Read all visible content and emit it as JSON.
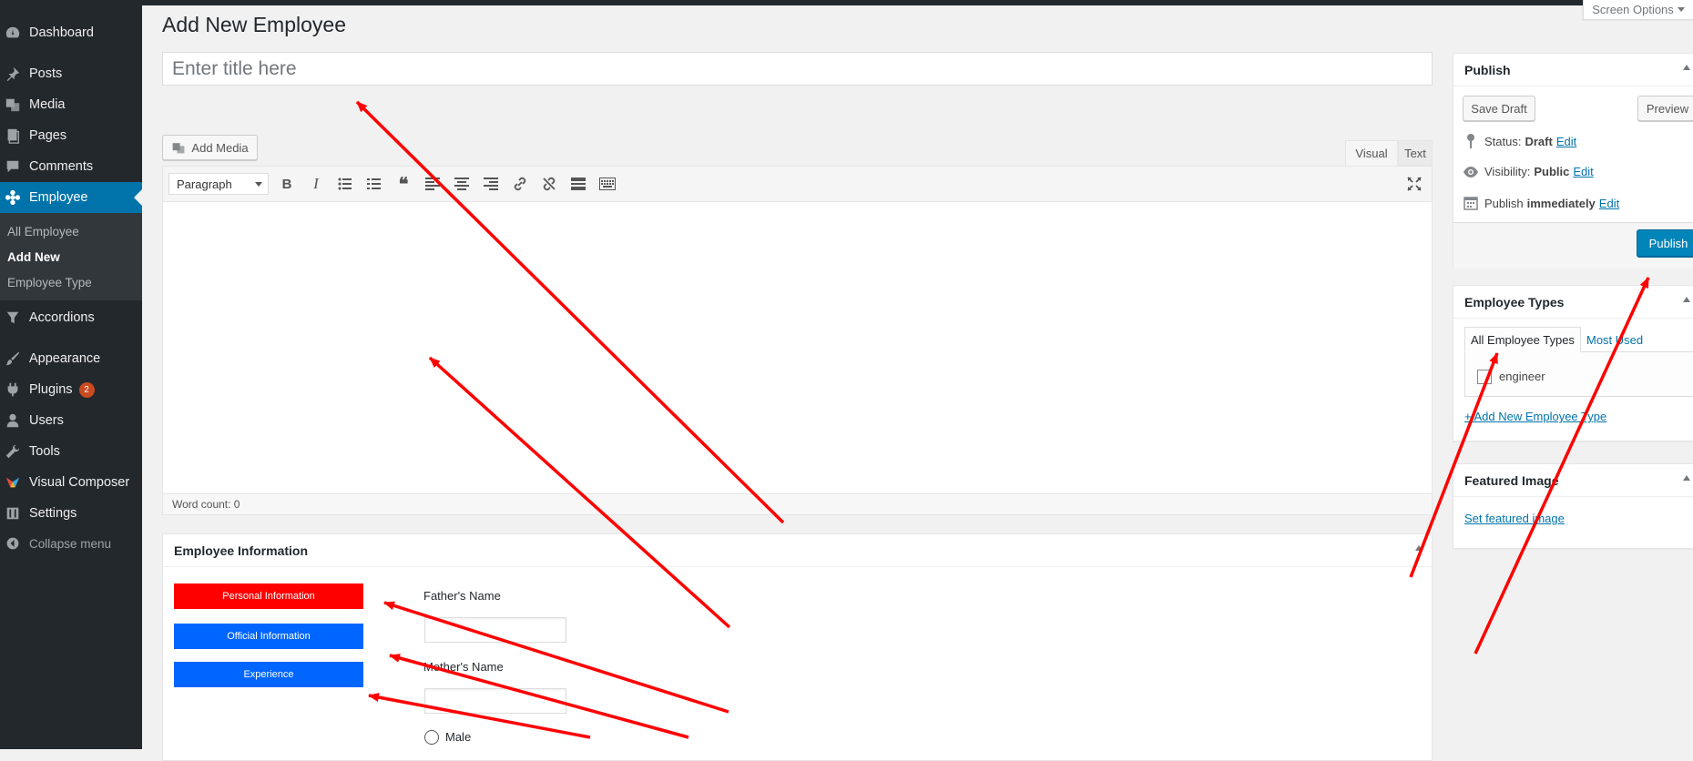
{
  "sidebar": {
    "items": [
      {
        "label": "Dashboard",
        "icon": "dashboard-icon"
      },
      {
        "label": "Posts",
        "icon": "pin-icon"
      },
      {
        "label": "Media",
        "icon": "media-icon"
      },
      {
        "label": "Pages",
        "icon": "pages-icon"
      },
      {
        "label": "Comments",
        "icon": "comment-icon"
      },
      {
        "label": "Employee",
        "icon": "flower-icon"
      },
      {
        "label": "Accordions",
        "icon": "filter-icon"
      },
      {
        "label": "Appearance",
        "icon": "brush-icon"
      },
      {
        "label": "Plugins",
        "icon": "plug-icon",
        "badge": "2"
      },
      {
        "label": "Users",
        "icon": "user-icon"
      },
      {
        "label": "Tools",
        "icon": "wrench-icon"
      },
      {
        "label": "Visual Composer",
        "icon": "vc-logo-icon"
      },
      {
        "label": "Settings",
        "icon": "settings-icon"
      }
    ],
    "submenu": [
      "All Employee",
      "Add New",
      "Employee Type"
    ],
    "collapse_label": "Collapse menu"
  },
  "header": {
    "page_title": "Add New Employee",
    "screen_options": "Screen Options"
  },
  "editor": {
    "title_placeholder": "Enter title here",
    "add_media": "Add Media",
    "tabs": [
      "Visual",
      "Text"
    ],
    "format_select": "Paragraph",
    "word_count": "Word count: 0"
  },
  "employee_info": {
    "title": "Employee Information",
    "tabs": [
      "Personal Information",
      "Official Information",
      "Experience"
    ],
    "tab_colors": [
      "#ff0000",
      "#0066ff",
      "#0066ff"
    ],
    "fields": [
      "Father's Name",
      "Mother's Name"
    ],
    "radio_label": "Male"
  },
  "publish": {
    "title": "Publish",
    "save_draft": "Save Draft",
    "preview": "Preview",
    "status_label": "Status:",
    "status_value": "Draft",
    "visibility_label": "Visibility:",
    "visibility_value": "Public",
    "publish_label": "Publish",
    "publish_value": "immediately",
    "edit": "Edit",
    "publish_button": "Publish"
  },
  "employee_types": {
    "title": "Employee Types",
    "tab_all": "All Employee Types",
    "tab_most_used": "Most Used",
    "items": [
      "engineer"
    ],
    "add_new": "+ Add New Employee Type"
  },
  "featured_image": {
    "title": "Featured Image",
    "set_link": "Set featured image"
  },
  "colors": {
    "sidebar_bg": "#23282d",
    "accent": "#0073aa",
    "arrow": "#ff0000"
  }
}
